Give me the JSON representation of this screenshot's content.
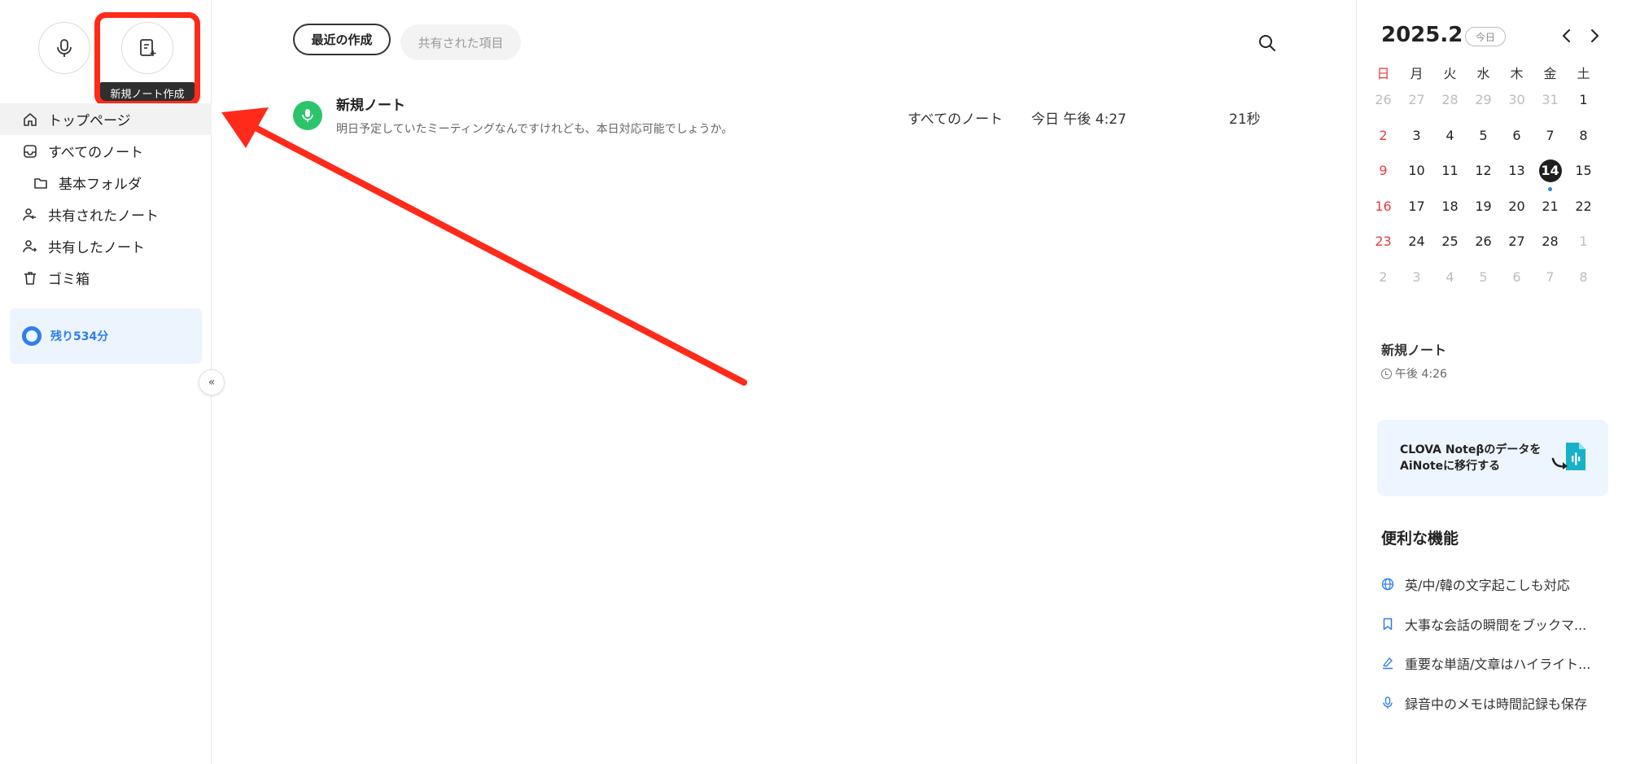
{
  "sidebar": {
    "tooltip": "新規ノート作成",
    "nav": [
      {
        "label": "トップページ"
      },
      {
        "label": "すべてのノート"
      },
      {
        "label": "基本フォルダ"
      },
      {
        "label": "共有されたノート"
      },
      {
        "label": "共有したノート"
      },
      {
        "label": "ゴミ箱"
      }
    ],
    "remaining": "残り534分",
    "collapse_glyph": "«"
  },
  "main": {
    "tabs": [
      "最近の作成",
      "共有された項目"
    ],
    "notes": [
      {
        "title": "新規ノート",
        "preview": "明日予定していたミーティングなんですけれども、本日対応可能でしょうか。",
        "folder": "すべてのノート",
        "date": "今日 午後 4:27",
        "duration": "21秒"
      }
    ]
  },
  "calendar": {
    "title": "2025.2",
    "today_label": "今日",
    "weekdays": [
      "日",
      "月",
      "火",
      "水",
      "木",
      "金",
      "土"
    ],
    "weeks": [
      [
        "26",
        "27",
        "28",
        "29",
        "30",
        "31",
        "1"
      ],
      [
        "2",
        "3",
        "4",
        "5",
        "6",
        "7",
        "8"
      ],
      [
        "9",
        "10",
        "11",
        "12",
        "13",
        "14",
        "15"
      ],
      [
        "16",
        "17",
        "18",
        "19",
        "20",
        "21",
        "22"
      ],
      [
        "23",
        "24",
        "25",
        "26",
        "27",
        "28",
        "1"
      ],
      [
        "2",
        "3",
        "4",
        "5",
        "6",
        "7",
        "8"
      ]
    ],
    "selected_day": "14"
  },
  "event": {
    "title": "新規ノート",
    "time": "午後 4:26"
  },
  "migrate": {
    "line1": "CLOVA Noteβのデータを",
    "line2": "AiNoteに移行する"
  },
  "features": {
    "title": "便利な機能",
    "items": [
      {
        "icon": "globe-icon",
        "label": "英/中/韓の文字起こしも対応"
      },
      {
        "icon": "bookmark-icon",
        "label": "大事な会話の瞬間をブックマ..."
      },
      {
        "icon": "highlighter-icon",
        "label": "重要な単語/文章はハイライト..."
      },
      {
        "icon": "mic-icon",
        "label": "録音中のメモは時間記録も保存"
      }
    ]
  },
  "colors": {
    "accent_blue": "#2f7fea",
    "note_green": "#2cc46b",
    "annotation_red": "#ff2a1a",
    "sunday_red": "#e83b3b"
  }
}
